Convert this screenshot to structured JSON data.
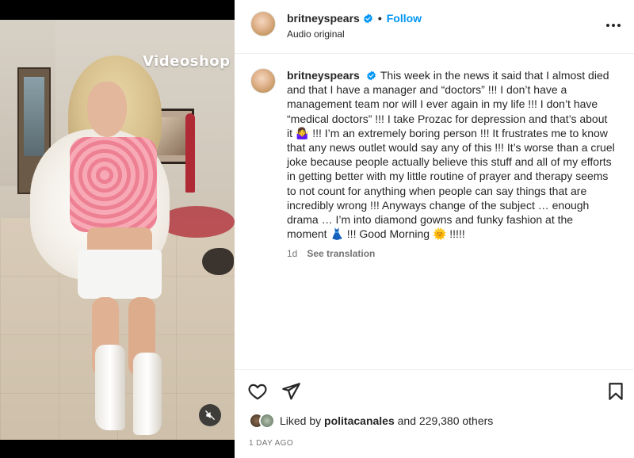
{
  "media": {
    "watermark": "Videoshop"
  },
  "header": {
    "username": "britneyspears",
    "dot": "•",
    "follow_label": "Follow",
    "audio_label": "Audio original"
  },
  "caption": {
    "username": "britneyspears",
    "text": "This week in the news it said that I almost died and that I have a manager and “doctors” !!! I don’t have a management team nor will I ever again in my life !!! I don’t have “medical doctors” !!! I take Prozac for depression and that’s about it 🤷‍♀️ !!! I’m an extremely boring person !!! It frustrates me to know that any news outlet would say any of this !!! It’s worse than a cruel joke because people actually believe this stuff and all of my efforts in getting better with my little routine of prayer and therapy seems to not count for anything when people can say things that are incredibly wrong !!! Anyways change of the subject … enough drama … I’m into diamond gowns and funky fashion at the moment 👗 !!! Good Morning 🌞 !!!!!",
    "age": "1d",
    "see_translation": "See translation"
  },
  "likes": {
    "prefix": "Liked by",
    "user": "politacanales",
    "suffix": "and 229,380 others"
  },
  "timestamp": "1 DAY AGO",
  "colors": {
    "accent": "#0095f6",
    "verified": "#0095f6",
    "text": "#262626",
    "secondary": "#737373"
  },
  "icons": {
    "verified": "verified-badge-icon",
    "more": "more-options-icon",
    "like": "heart-icon",
    "share": "send-icon",
    "save": "bookmark-icon",
    "mute": "muted-speaker-icon"
  }
}
